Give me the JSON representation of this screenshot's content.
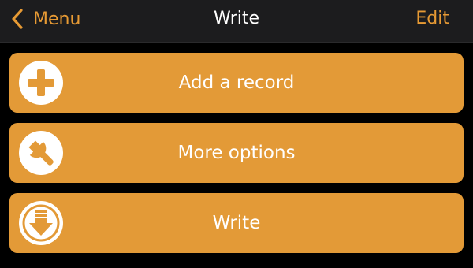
{
  "navbar": {
    "back_label": "Menu",
    "back_icon": "chevron-left-icon",
    "title": "Write",
    "edit_label": "Edit"
  },
  "actions": [
    {
      "label": "Add a record",
      "icon": "plus-circle-icon"
    },
    {
      "label": "More options",
      "icon": "wrench-icon"
    },
    {
      "label": "Write",
      "icon": "download-icon"
    }
  ],
  "colors": {
    "accent": "#e79a34",
    "button_background": "#e39a37",
    "navbar_background": "#1c1c1e",
    "page_background": "#000000",
    "text": "#ffffff"
  }
}
